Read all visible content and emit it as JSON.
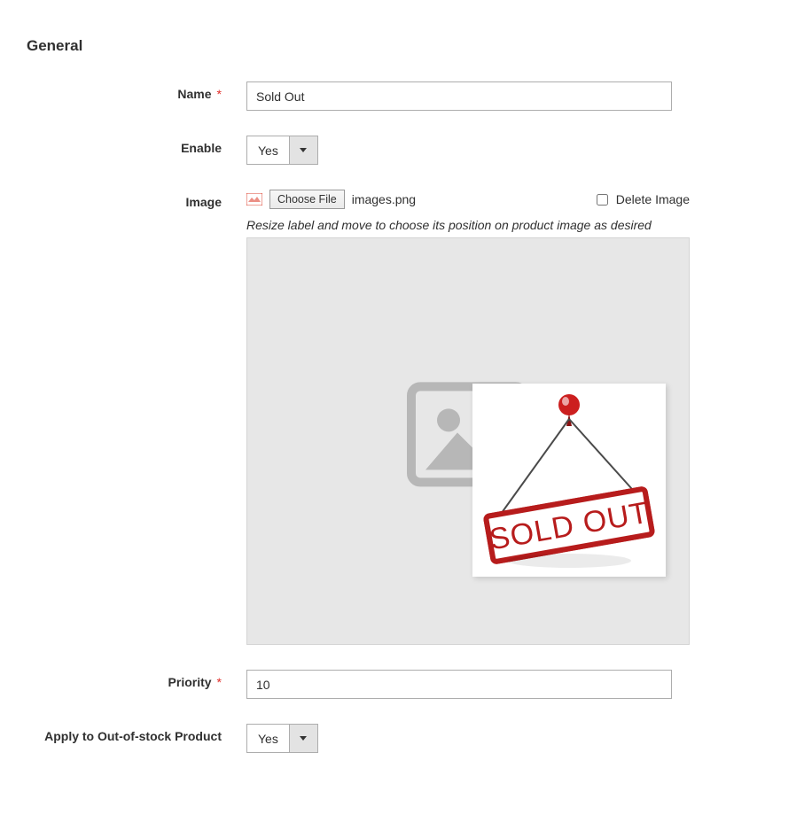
{
  "section": {
    "title": "General"
  },
  "fields": {
    "name": {
      "label": "Name",
      "value": "Sold Out"
    },
    "enable": {
      "label": "Enable",
      "value": "Yes"
    },
    "image": {
      "label": "Image",
      "choose_btn": "Choose File",
      "file_name": "images.png",
      "delete_label": "Delete Image",
      "hint": "Resize label and move to choose its position on product image as desired",
      "overlay_text": "SOLD OUT"
    },
    "priority": {
      "label": "Priority",
      "value": "10"
    },
    "apply_oos": {
      "label": "Apply to Out-of-stock Product",
      "value": "Yes"
    }
  }
}
